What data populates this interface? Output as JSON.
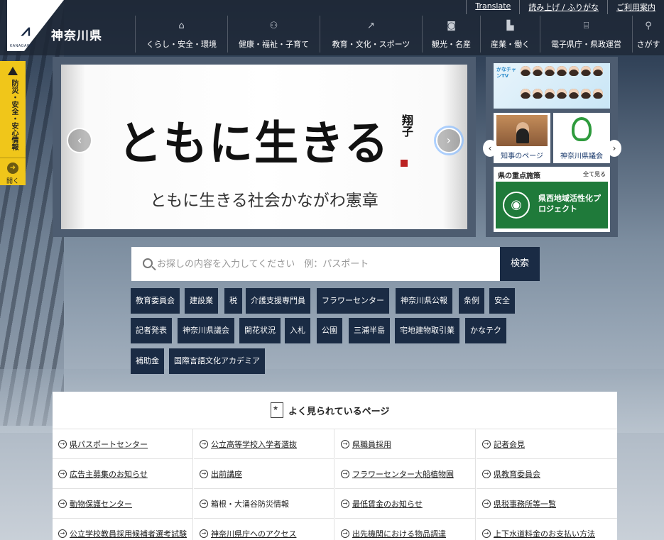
{
  "header": {
    "site_title": "神奈川県",
    "logo_glyph": "𐂂",
    "logo_sub": "KANAGAWA",
    "util_links": [
      "Translate",
      "読み上げ / ふりがな",
      "ご利用案内"
    ],
    "nav": [
      {
        "label": "くらし・安全・環境",
        "icon": "home-icon"
      },
      {
        "label": "健康・福祉・子育て",
        "icon": "family-icon"
      },
      {
        "label": "教育・文化・スポーツ",
        "icon": "running-icon"
      },
      {
        "label": "観光・名産",
        "icon": "camera-icon"
      },
      {
        "label": "産業・働く",
        "icon": "factory-icon"
      },
      {
        "label": "電子県庁・県政運営",
        "icon": "building-icon"
      },
      {
        "label": "さがす",
        "icon": "search-icon"
      }
    ]
  },
  "disaster": {
    "label": "防災・安全・安心情報",
    "open_label": "開く"
  },
  "carousel": {
    "calligraphy": "ともに生きる",
    "signature": "翔子",
    "caption": "ともに生きる社会かながわ憲章"
  },
  "side": {
    "tv_logo": "かなチャンTV",
    "governor_label": "知事のページ",
    "council_label": "神奈川県議会",
    "policy_heading": "県の重点施策",
    "policy_all": "全て見る",
    "policy_banner": "県西地域活性化プロジェクト"
  },
  "search": {
    "placeholder": "お探しの内容を入力してください　例：パスポート",
    "button": "検索"
  },
  "tags": [
    "教育委員会",
    "建設業",
    "税",
    "介護支援専門員",
    "フラワーセンター",
    "神奈川県公報",
    "条例",
    "安全",
    "記者発表",
    "神奈川県議会",
    "開花状況",
    "入札",
    "公園",
    "三浦半島",
    "宅地建物取引業",
    "かなテク",
    "補助金",
    "国際言語文化アカデミア"
  ],
  "popular": {
    "title": "よく見られているページ",
    "items": [
      "県パスポートセンター",
      "公立高等学校入学者選抜",
      "県職員採用",
      "記者会見",
      "広告主募集のお知らせ",
      "出前講座",
      "フラワーセンター大船植物園",
      "県教育委員会",
      "動物保護センター",
      "箱根・大涌谷防災情報",
      "最低賃金のお知らせ",
      "県税事務所等一覧",
      "公立学校教員採用候補者選考試験",
      "神奈川県庁へのアクセス",
      "出先機関における物品調達",
      "上下水道料金のお支払い方法"
    ]
  },
  "colors": {
    "header_bg": "#1e2634",
    "accent_navy": "#1a2b44",
    "disaster_yellow": "#f0c61a",
    "policy_green": "#1f7a3a"
  }
}
